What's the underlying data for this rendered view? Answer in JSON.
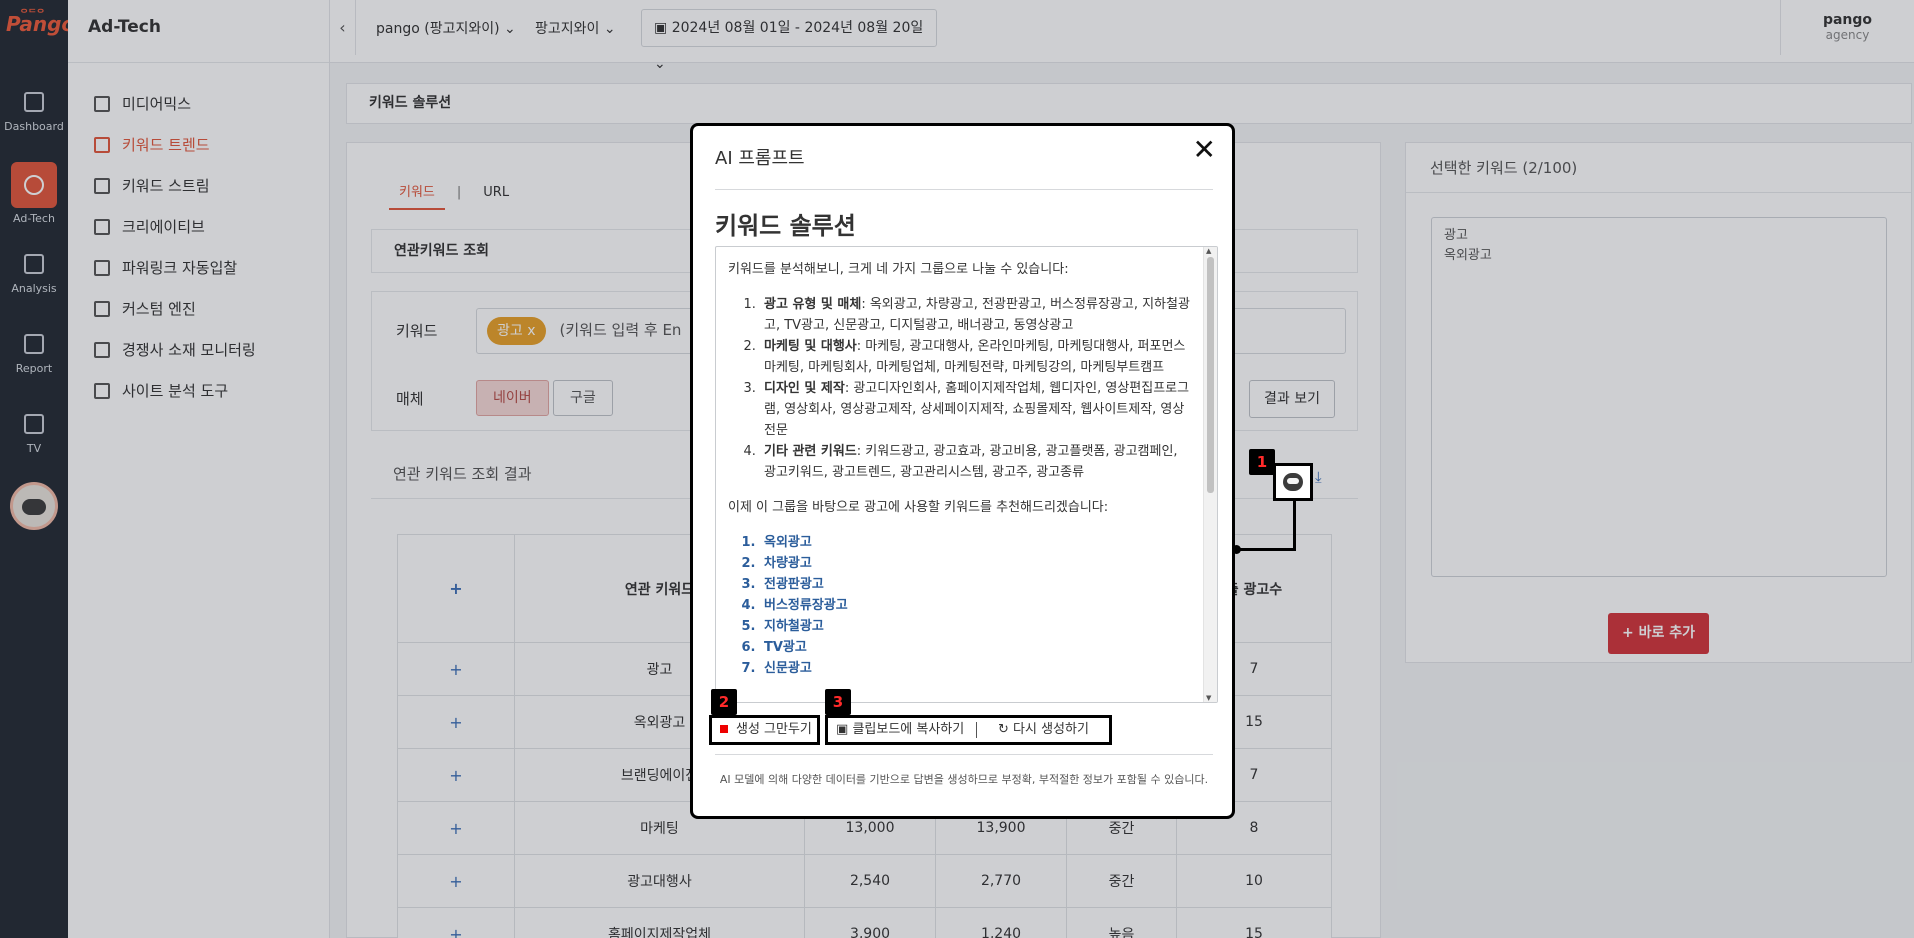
{
  "rail": {
    "items": [
      {
        "label": "Dashboard",
        "icon": "dashboard-icon"
      },
      {
        "label": "Ad-Tech",
        "icon": "gauge-icon",
        "active": true
      },
      {
        "label": "Analysis",
        "icon": "sliders-icon"
      },
      {
        "label": "Report",
        "icon": "report-icon"
      },
      {
        "label": "TV",
        "icon": "tv-icon"
      }
    ]
  },
  "sidebar": {
    "title": "Ad-Tech",
    "items": [
      {
        "label": "미디어믹스"
      },
      {
        "label": "키워드 트렌드",
        "active": true
      },
      {
        "label": "키워드 스트림"
      },
      {
        "label": "크리에이티브"
      },
      {
        "label": "파워링크 자동입찰"
      },
      {
        "label": "커스텀 엔진"
      },
      {
        "label": "경쟁사 소재 모니터링"
      },
      {
        "label": "사이트 분석 도구"
      }
    ]
  },
  "topbar": {
    "account": "pango (팡고지와이)",
    "brand": "팡고지와이",
    "date_range": "2024년 08월 01일 - 2024년 08월 20일",
    "user_name": "pango",
    "user_role": "agency"
  },
  "page": {
    "breadcrumb": "키워드 솔루션",
    "tabs": [
      "키워드",
      "URL"
    ],
    "tab_separator": "|",
    "section_title": "연관키워드 조회",
    "keyword_label": "키워드",
    "keyword_chip": "광고 x",
    "keyword_placeholder": "(키워드 입력 후 En",
    "media_label": "매체",
    "media_options": [
      "네이버",
      "구글"
    ],
    "result_button": "결과 보기",
    "result_title": "연관 키워드 조회 결과"
  },
  "table": {
    "headers": [
      "+",
      "연관 키워드",
      "",
      "",
      "",
      "출 광고수"
    ],
    "rows": [
      {
        "keyword": "광고",
        "c1": "",
        "c2": "",
        "c3": "",
        "ads": "7"
      },
      {
        "keyword": "옥외광고",
        "c1": "",
        "c2": "",
        "c3": "",
        "ads": "15"
      },
      {
        "keyword": "브랜딩에이전",
        "c1": "",
        "c2": "",
        "c3": "",
        "ads": "7"
      },
      {
        "keyword": "마케팅",
        "c1": "13,000",
        "c2": "13,900",
        "c3": "중간",
        "ads": "8"
      },
      {
        "keyword": "광고대행사",
        "c1": "2,540",
        "c2": "2,770",
        "c3": "중간",
        "ads": "10"
      },
      {
        "keyword": "홈페이지제작업체",
        "c1": "3,900",
        "c2": "1,240",
        "c3": "높음",
        "ads": "15"
      }
    ]
  },
  "selected": {
    "title": "선택한 키워드 (2/100)",
    "keywords": [
      "광고",
      "옥외광고"
    ],
    "add_button": "+ 바로 추가"
  },
  "modal": {
    "title": "AI 프롬프트",
    "close": "✕",
    "heading": "키워드 솔루션",
    "intro": "키워드를 분석해보니, 크게 네 가지 그룹으로 나눌 수 있습니다:",
    "groups": [
      {
        "name": "광고 유형 및 매체",
        "text": ": 옥외광고, 차량광고, 전광판광고, 버스정류장광고, 지하철광고, TV광고, 신문광고, 디지털광고, 배너광고, 동영상광고"
      },
      {
        "name": "마케팅 및 대행사",
        "text": ": 마케팅, 광고대행사, 온라인마케팅, 마케팅대행사, 퍼포먼스마케팅, 마케팅회사, 마케팅업체, 마케팅전략, 마케팅강의, 마케팅부트캠프"
      },
      {
        "name": "디자인 및 제작",
        "text": ": 광고디자인회사, 홈페이지제작업체, 웹디자인, 영상편집프로그램, 영상회사, 영상광고제작, 상세페이지제작, 쇼핑몰제작, 웹사이트제작, 영상전문"
      },
      {
        "name": "기타 관련 키워드",
        "text": ": 키워드광고, 광고효과, 광고비용, 광고플랫폼, 광고캠페인, 광고키워드, 광고트렌드, 광고관리시스템, 광고주, 광고종류"
      }
    ],
    "recommend_intro": "이제 이 그룹을 바탕으로 광고에 사용할 키워드를 추천해드리겠습니다:",
    "recommended": [
      "옥외광고",
      "차량광고",
      "전광판광고",
      "버스정류장광고",
      "지하철광고",
      "TV광고",
      "신문광고"
    ],
    "stop_button": "생성 그만두기",
    "copy_button": "클립보드에 복사하기",
    "regen_button": "다시 생성하기",
    "disclaimer": "AI 모델에 의해 다양한 데이터를 기반으로 답변을 생성하므로 부정확, 부적절한 정보가 포함될 수 있습니다."
  },
  "callouts": [
    "1",
    "2",
    "3"
  ],
  "colors": {
    "accent": "#e2573b",
    "danger": "#d2343a",
    "chip": "#e8a128",
    "link": "#2b5d9b"
  }
}
